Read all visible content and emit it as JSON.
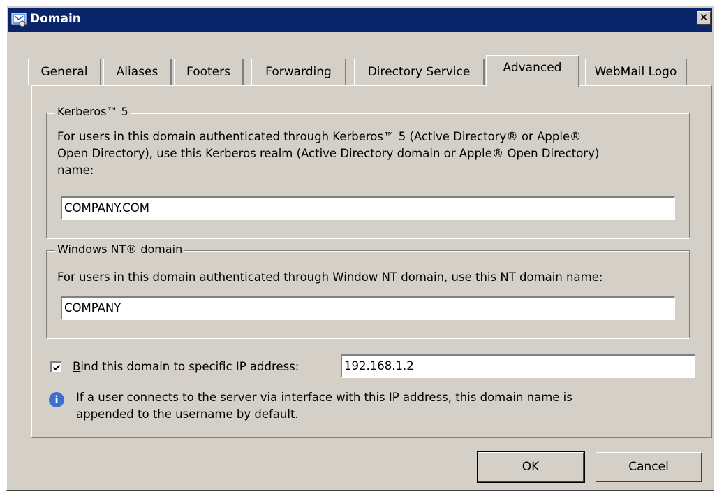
{
  "window": {
    "title": "Domain",
    "close_label": "✕"
  },
  "tabs": [
    {
      "label": "General",
      "active": false
    },
    {
      "label": "Aliases",
      "active": false
    },
    {
      "label": "Footers",
      "active": false
    },
    {
      "label": "Forwarding",
      "active": false
    },
    {
      "label": "Directory Service",
      "active": false
    },
    {
      "label": "Advanced",
      "active": true
    },
    {
      "label": "WebMail Logo",
      "active": false
    }
  ],
  "kerberos": {
    "legend": "Kerberos™ 5",
    "description_line1": "For users in this domain authenticated through Kerberos™ 5 (Active Directory® or Apple®",
    "description_line2": "Open Directory), use this Kerberos realm (Active Directory domain or Apple® Open Directory)",
    "description_line3": "name:",
    "realm_value": "COMPANY.COM"
  },
  "nt_domain": {
    "legend": "Windows NT® domain",
    "description": "For users in this domain authenticated through Window NT domain, use this NT domain name:",
    "domain_value": "COMPANY"
  },
  "bind_ip": {
    "checked": true,
    "label_underlined": "B",
    "label_rest": "ind this domain to specific IP address:",
    "ip_value": "192.168.1.2"
  },
  "info": {
    "icon": "info-icon",
    "line1": "If a user connects to the server via interface with this IP address, this domain name is",
    "line2": "appended to the username by default."
  },
  "buttons": {
    "ok": "OK",
    "cancel": "Cancel"
  },
  "colors": {
    "titlebar": "#0a246a",
    "dialog_bg": "#d4d0c8",
    "info_icon": "#3d6fd1"
  }
}
